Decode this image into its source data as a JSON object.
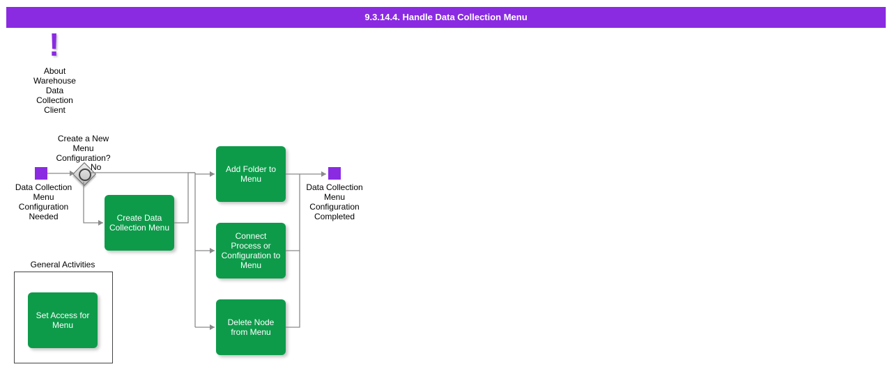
{
  "title": "9.3.14.4. Handle Data Collection Menu",
  "annotation": {
    "label": "About Warehouse Data Collection Client"
  },
  "start": {
    "label": "Data Collection Menu Configuration Needed"
  },
  "gateway": {
    "label": "Create a New Menu Configuration?",
    "no_label": "No"
  },
  "tasks": {
    "create": "Create Data Collection Menu",
    "add": "Add Folder to Menu",
    "connect": "Connect Process or Configuration to Menu",
    "delete": "Delete Node from Menu",
    "access": "Set Access for Menu"
  },
  "end": {
    "label": "Data Collection Menu Configuration Completed"
  },
  "general_activities": {
    "title": "General Activities"
  }
}
